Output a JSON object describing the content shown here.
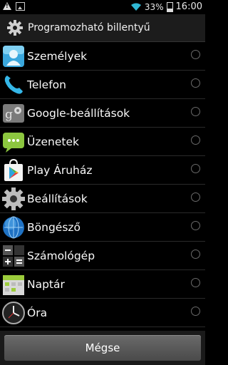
{
  "status_bar": {
    "battery_percent": "33%",
    "time": "16:00",
    "icons": [
      "warning-icon",
      "image-icon",
      "wifi-icon",
      "battery-icon"
    ]
  },
  "dialog": {
    "title": "Programozható billentyű",
    "title_icon": "gear-icon"
  },
  "apps": [
    {
      "label": "Személyek",
      "icon": "contacts-icon"
    },
    {
      "label": "Telefon",
      "icon": "phone-icon"
    },
    {
      "label": "Google-beállítások",
      "icon": "google-settings-icon"
    },
    {
      "label": "Üzenetek",
      "icon": "messages-icon"
    },
    {
      "label": "Play Áruház",
      "icon": "play-store-icon"
    },
    {
      "label": "Beállítások",
      "icon": "settings-gear-icon"
    },
    {
      "label": "Böngésző",
      "icon": "browser-globe-icon"
    },
    {
      "label": "Számológép",
      "icon": "calculator-icon"
    },
    {
      "label": "Naptár",
      "icon": "calendar-icon"
    },
    {
      "label": "Óra",
      "icon": "clock-icon"
    }
  ],
  "cancel_label": "Mégse"
}
